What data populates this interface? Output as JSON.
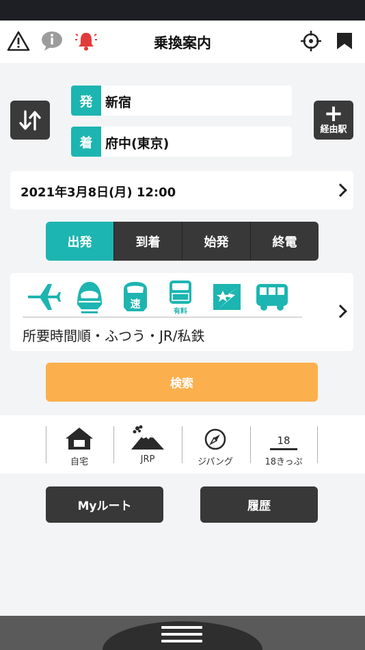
{
  "header": {
    "title": "乗換案内",
    "icons": [
      "warning-icon",
      "info-icon",
      "bell-icon",
      "crosshair-icon",
      "bookmark-icon"
    ]
  },
  "route": {
    "from_badge": "発",
    "from_station": "新宿",
    "to_badge": "着",
    "to_station": "府中(東京)",
    "via_label": "経由駅"
  },
  "datetime": {
    "text": "2021年3月8日(月) 12:00"
  },
  "time_modes": {
    "items": [
      "出発",
      "到着",
      "始発",
      "終電"
    ],
    "selected": "出発"
  },
  "transport": {
    "icons": [
      "airplane-icon",
      "shinkansen-icon",
      "express-icon",
      "paid-express-icon",
      "highway-bus-icon",
      "bus-icon"
    ],
    "express_mark": "速",
    "paid_mark": "有料",
    "options_text": "所要時間順・ふつう・JR/私鉄"
  },
  "search_label": "検索",
  "quick": {
    "home": "自宅",
    "jrp": "JRP",
    "zipangu": "ジパング",
    "seishun18": "18きっぷ",
    "seishun18_mark": "18"
  },
  "buttons": {
    "myroute": "Myルート",
    "history": "履歴"
  },
  "colors": {
    "teal": "#1db5b1",
    "orange": "#fbb04d",
    "dark": "#383838",
    "alert_red": "#e23b3b"
  }
}
